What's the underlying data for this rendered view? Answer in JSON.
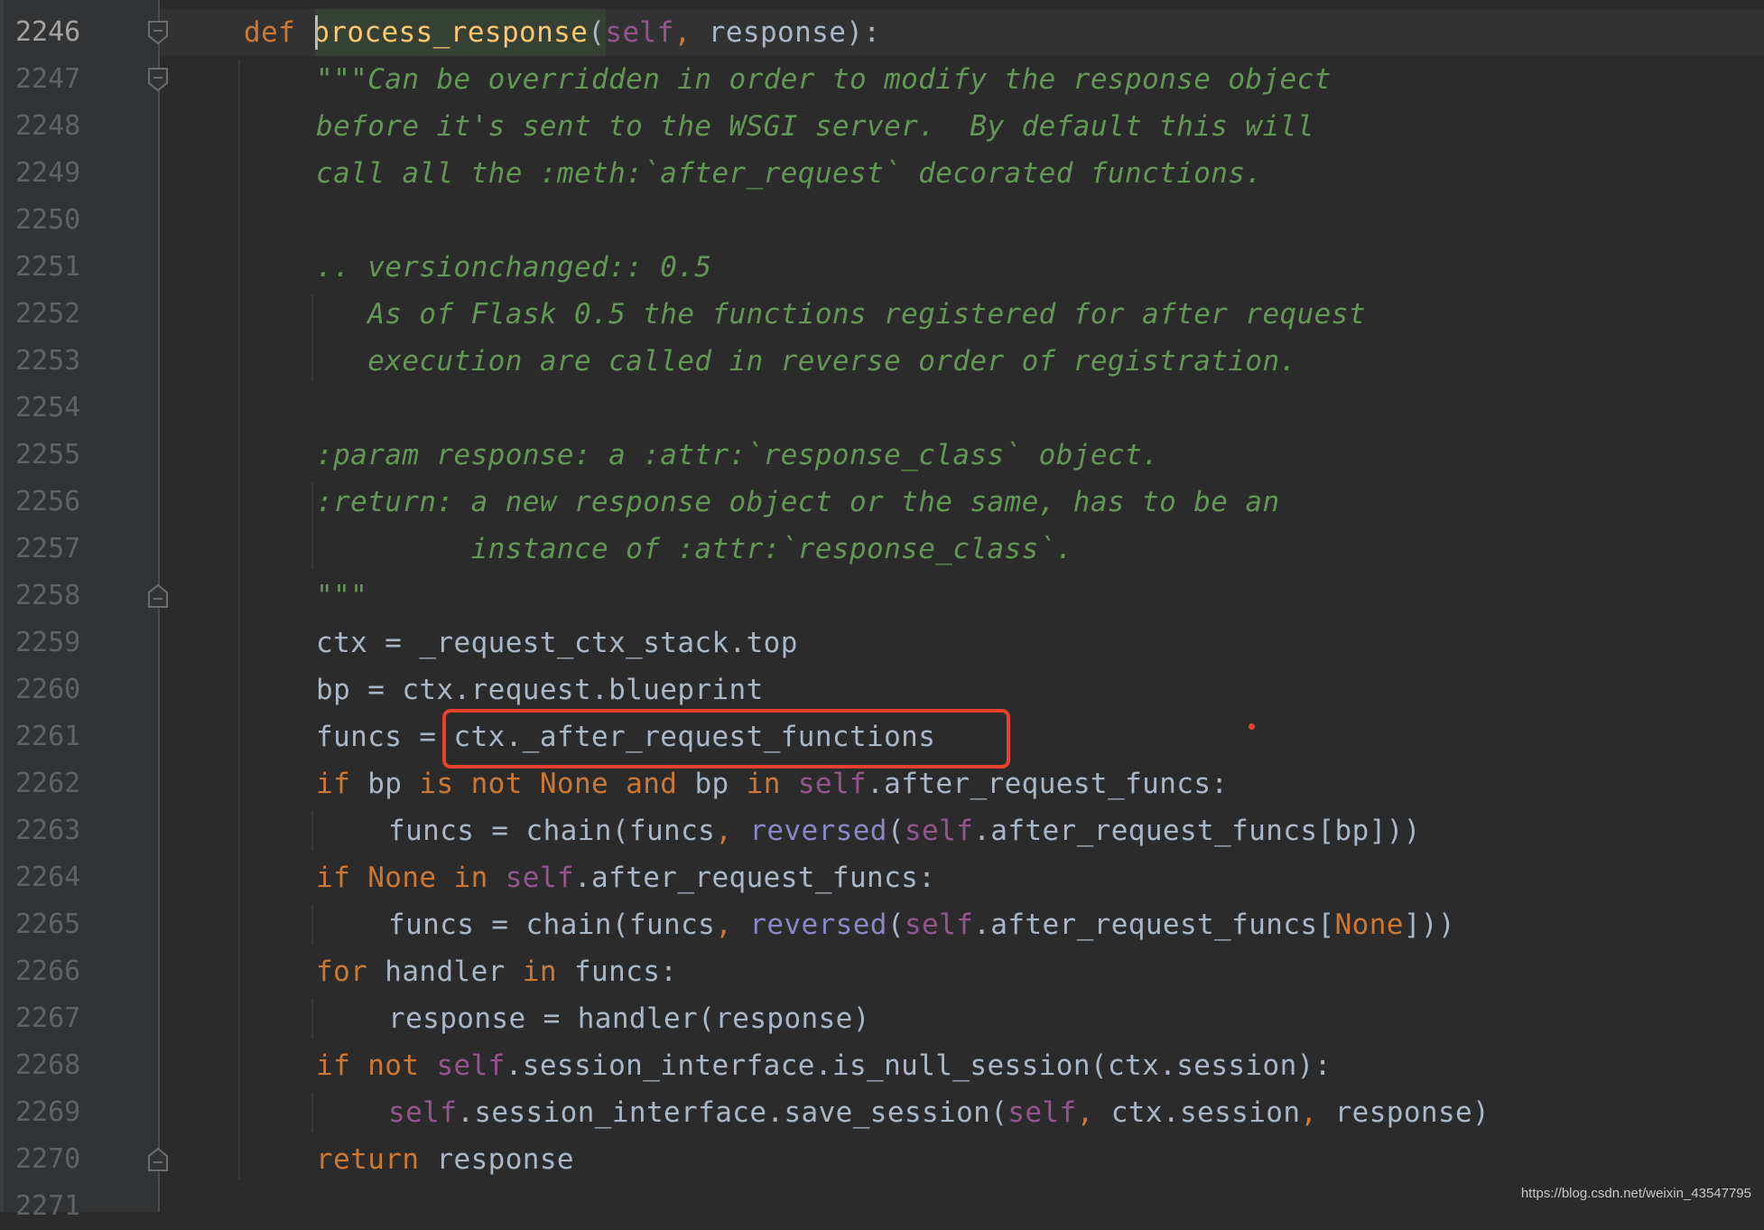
{
  "editor": {
    "current_line": 2246,
    "lines": [
      {
        "n": "2246",
        "indent": 0,
        "tokens": [
          [
            "kw",
            "def "
          ],
          [
            "fn",
            "process_response"
          ],
          [
            "plain",
            "("
          ],
          [
            "self",
            "self"
          ],
          [
            "comma",
            ", "
          ],
          [
            "plain",
            "response):"
          ]
        ]
      },
      {
        "n": "2247",
        "indent": 1,
        "tokens": [
          [
            "doc",
            "\"\"\"Can be overridden in order to modify the response object"
          ]
        ]
      },
      {
        "n": "2248",
        "indent": 1,
        "tokens": [
          [
            "doc",
            "before it's sent to the WSGI server.  By default this will"
          ]
        ]
      },
      {
        "n": "2249",
        "indent": 1,
        "tokens": [
          [
            "doc",
            "call all the :meth:`after_request` decorated functions."
          ]
        ]
      },
      {
        "n": "2250",
        "indent": 1,
        "tokens": []
      },
      {
        "n": "2251",
        "indent": 1,
        "tokens": [
          [
            "doc",
            ".. versionchanged:: 0.5"
          ]
        ]
      },
      {
        "n": "2252",
        "indent": 1,
        "tokens": [
          [
            "doc",
            "   As of Flask 0.5 the functions registered for after request"
          ]
        ]
      },
      {
        "n": "2253",
        "indent": 1,
        "tokens": [
          [
            "doc",
            "   execution are called in reverse order of registration."
          ]
        ]
      },
      {
        "n": "2254",
        "indent": 1,
        "tokens": []
      },
      {
        "n": "2255",
        "indent": 1,
        "tokens": [
          [
            "doc",
            ":param response: a :attr:`response_class` object."
          ]
        ]
      },
      {
        "n": "2256",
        "indent": 1,
        "tokens": [
          [
            "doc",
            ":return: a new response object or the same, has to be an"
          ]
        ]
      },
      {
        "n": "2257",
        "indent": 1,
        "tokens": [
          [
            "doc",
            "         instance of :attr:`response_class`."
          ]
        ]
      },
      {
        "n": "2258",
        "indent": 1,
        "tokens": [
          [
            "doc",
            "\"\"\""
          ]
        ]
      },
      {
        "n": "2259",
        "indent": 1,
        "tokens": [
          [
            "plain",
            "ctx = _request_ctx_stack.top"
          ]
        ]
      },
      {
        "n": "2260",
        "indent": 1,
        "tokens": [
          [
            "plain",
            "bp = ctx.request.blueprint"
          ]
        ]
      },
      {
        "n": "2261",
        "indent": 1,
        "tokens": [
          [
            "plain",
            "funcs = ctx._after_request_functions"
          ]
        ]
      },
      {
        "n": "2262",
        "indent": 1,
        "tokens": [
          [
            "kw",
            "if "
          ],
          [
            "plain",
            "bp "
          ],
          [
            "kw",
            "is not None and "
          ],
          [
            "plain",
            "bp "
          ],
          [
            "kw",
            "in "
          ],
          [
            "self",
            "self"
          ],
          [
            "plain",
            ".after_request_funcs:"
          ]
        ]
      },
      {
        "n": "2263",
        "indent": 2,
        "tokens": [
          [
            "plain",
            "funcs = chain(funcs"
          ],
          [
            "comma",
            ", "
          ],
          [
            "builtin",
            "reversed"
          ],
          [
            "plain",
            "("
          ],
          [
            "self",
            "self"
          ],
          [
            "plain",
            ".after_request_funcs[bp]))"
          ]
        ]
      },
      {
        "n": "2264",
        "indent": 1,
        "tokens": [
          [
            "kw",
            "if None in "
          ],
          [
            "self",
            "self"
          ],
          [
            "plain",
            ".after_request_funcs:"
          ]
        ]
      },
      {
        "n": "2265",
        "indent": 2,
        "tokens": [
          [
            "plain",
            "funcs = chain(funcs"
          ],
          [
            "comma",
            ", "
          ],
          [
            "builtin",
            "reversed"
          ],
          [
            "plain",
            "("
          ],
          [
            "self",
            "self"
          ],
          [
            "plain",
            ".after_request_funcs["
          ],
          [
            "kw",
            "None"
          ],
          [
            "plain",
            "]))"
          ]
        ]
      },
      {
        "n": "2266",
        "indent": 1,
        "tokens": [
          [
            "kw",
            "for "
          ],
          [
            "plain",
            "handler "
          ],
          [
            "kw",
            "in "
          ],
          [
            "plain",
            "funcs:"
          ]
        ]
      },
      {
        "n": "2267",
        "indent": 2,
        "tokens": [
          [
            "plain",
            "response = handler(response)"
          ]
        ]
      },
      {
        "n": "2268",
        "indent": 1,
        "tokens": [
          [
            "kw",
            "if not "
          ],
          [
            "self",
            "self"
          ],
          [
            "plain",
            ".session_interface.is_null_session(ctx.session):"
          ]
        ]
      },
      {
        "n": "2269",
        "indent": 2,
        "tokens": [
          [
            "self",
            "self"
          ],
          [
            "plain",
            ".session_interface.save_session("
          ],
          [
            "self",
            "self"
          ],
          [
            "comma",
            ", "
          ],
          [
            "plain",
            "ctx.session"
          ],
          [
            "comma",
            ", "
          ],
          [
            "plain",
            "response)"
          ]
        ]
      },
      {
        "n": "2270",
        "indent": 1,
        "tokens": [
          [
            "kw",
            "return "
          ],
          [
            "plain",
            "response"
          ]
        ]
      },
      {
        "n": "2271",
        "indent": 0,
        "tokens": []
      }
    ],
    "fold_markers": [
      {
        "line": "2246",
        "type": "start"
      },
      {
        "line": "2247",
        "type": "start"
      },
      {
        "line": "2258",
        "type": "end"
      },
      {
        "line": "2270",
        "type": "end"
      }
    ]
  },
  "annotation": {
    "highlighted_text": "ctx._after_request_functions",
    "color": "#e8412c"
  },
  "watermark": "https://blog.csdn.net/weixin_43547795"
}
